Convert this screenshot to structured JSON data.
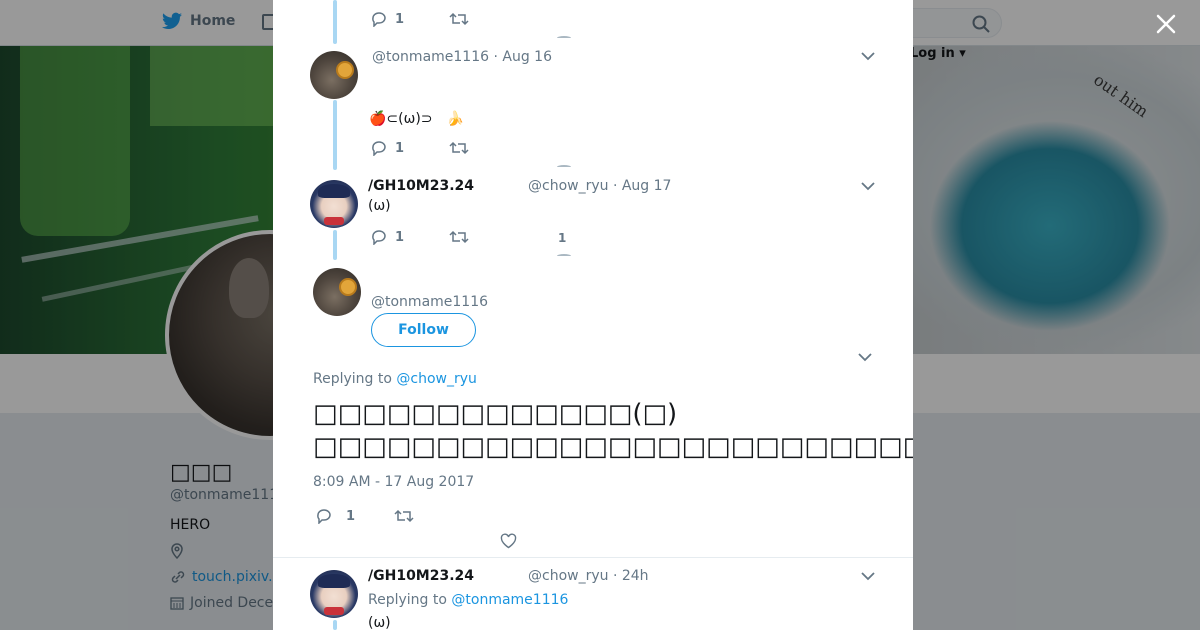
{
  "background": {
    "nav": {
      "home_label": "Home",
      "login_label": "Log in"
    },
    "banner_text": "out him",
    "profile": {
      "name": "□□□",
      "handle": "@tonmame111",
      "bio": "HERO",
      "link_text": "touch.pixiv.",
      "joined_text": "Joined Dece"
    }
  },
  "modal": {
    "tweets": [
      {
        "reply_count": "1"
      },
      {
        "handle": "@tonmame1116",
        "date": "Aug 16",
        "text": "🍎⊂(ω)⊃　🍌",
        "reply_count": "1"
      },
      {
        "name": "/GH10M23.24",
        "handle": "@chow_ryu",
        "date": "Aug 17",
        "text": "(ω)",
        "reply_count": "1",
        "like_count": "1"
      }
    ],
    "main": {
      "handle": "@tonmame1116",
      "follow_label": "Follow",
      "replying_prefix": "Replying to",
      "replying_to": "@chow_ryu",
      "line1": "□□□□□□□□□□□□□(□)",
      "line2": "□□□□□□□□□□□□□□□□□□□□□□□□□□□□□□□□□□□□□□□□□□□□□□□□□□",
      "timestamp": "8:09 AM - 17 Aug 2017",
      "reply_count": "1"
    },
    "reply": {
      "name": "/GH10M23.24",
      "handle": "@chow_ryu",
      "date": "24h",
      "replying_prefix": "Replying to",
      "replying_to": "@tonmame1116",
      "text": "(ω)"
    }
  },
  "colors": {
    "accent": "#1b95e0",
    "muted": "#657786",
    "thread": "#a9d7f3"
  }
}
